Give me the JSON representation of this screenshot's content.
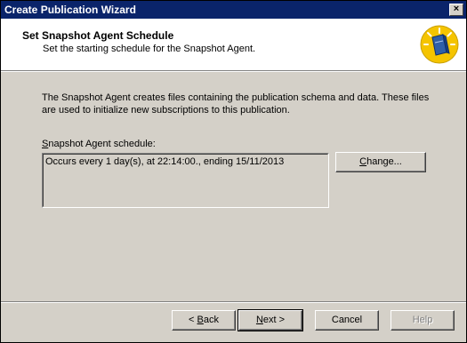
{
  "window": {
    "title": "Create Publication Wizard",
    "close_label": "×"
  },
  "header": {
    "title": "Set Snapshot Agent Schedule",
    "subtitle": "Set the starting schedule for the Snapshot Agent.",
    "icon": "wizard-book-icon"
  },
  "body": {
    "intro": "The Snapshot Agent creates files containing the publication schema and data. These files are used to initialize new subscriptions to this publication.",
    "schedule_label": {
      "mnemonic": "S",
      "rest": "napshot Agent schedule:"
    },
    "schedule_value": "Occurs every 1 day(s), at 22:14:00., ending 15/11/2013",
    "change_button": {
      "mnemonic": "C",
      "rest": "hange..."
    }
  },
  "footer": {
    "back": {
      "prefix": "< ",
      "mnemonic": "B",
      "rest": "ack"
    },
    "next": {
      "mnemonic": "N",
      "rest": "ext >"
    },
    "cancel": "Cancel",
    "help": "Help"
  },
  "colors": {
    "titlebar": "#0a246a",
    "dialog": "#d4d0c8",
    "badge": "#f5c400"
  }
}
